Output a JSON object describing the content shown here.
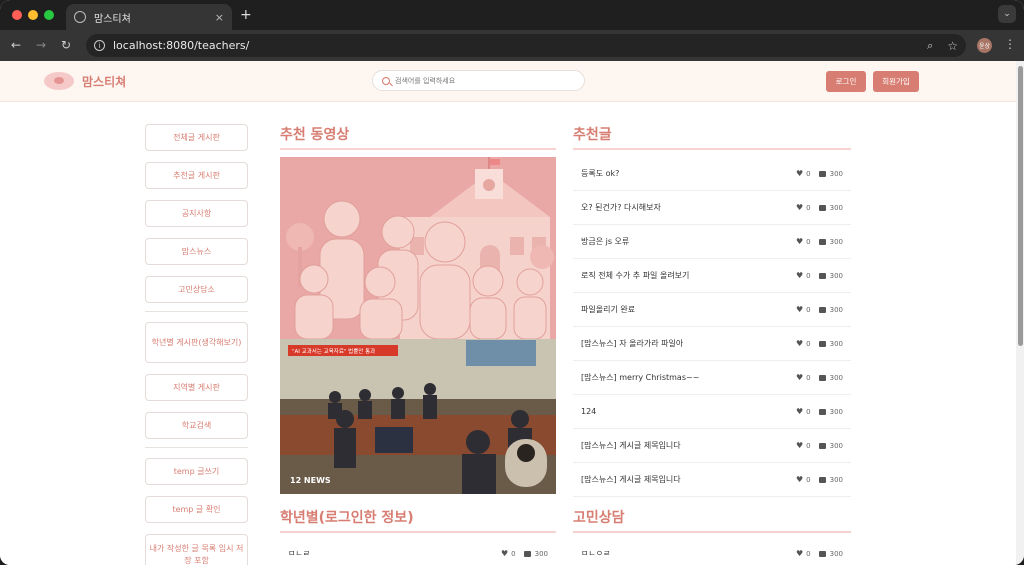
{
  "browser": {
    "tab_title": "맘스티쳐",
    "tab_close": "×",
    "new_tab": "+",
    "url": "localhost:8080/teachers/",
    "profile_initials": "윤상"
  },
  "header": {
    "brand": "맘스티쳐",
    "search_placeholder": "검색어를 입력하세요",
    "login_label": "로그인",
    "signup_label": "회원가입",
    "accent_color": "#d87d72"
  },
  "sidebar": {
    "group1": [
      "전체글 게시판",
      "추천글 게시판",
      "공지사항",
      "맘스뉴스",
      "고민상담소"
    ],
    "group2": [
      "학년별 게시판(생각해보기)",
      "지역별 게시판",
      "학교검색"
    ],
    "group3": [
      "temp 글쓰기",
      "temp 글 확인",
      "내가 작성한 글 목록 임시 저장 포함"
    ]
  },
  "sections": {
    "video_title": "추천 동영상",
    "recommended_title": "추천글",
    "grade_title": "학년별(로그인한 정보)",
    "counsel_title": "고민상담"
  },
  "video": {
    "news_banner": "\"AI 교과서는 교육자료\" 법률안 통과",
    "news_logo": "12 NEWS"
  },
  "recommended_posts": [
    {
      "title": "등록도 ok?",
      "likes": "0",
      "comments": "300"
    },
    {
      "title": "오? 된건가? 다시해보자",
      "likes": "0",
      "comments": "300"
    },
    {
      "title": "방금은 js 오류",
      "likes": "0",
      "comments": "300"
    },
    {
      "title": "로직 전체 수가 추 파일 올려보기",
      "likes": "0",
      "comments": "300"
    },
    {
      "title": "파일올리기 완료",
      "likes": "0",
      "comments": "300"
    },
    {
      "title": "[맘스뉴스] 자 올라가라 파일아",
      "likes": "0",
      "comments": "300"
    },
    {
      "title": "[맘스뉴스] merry Christmas~~",
      "likes": "0",
      "comments": "300"
    },
    {
      "title": "124",
      "likes": "0",
      "comments": "300"
    },
    {
      "title": "[맘스뉴스] 게시글 제목입니다",
      "likes": "0",
      "comments": "300"
    },
    {
      "title": "[맘스뉴스] 게시글 제목입니다",
      "likes": "0",
      "comments": "300"
    }
  ],
  "grade_posts": [
    {
      "title": "ㅁㄴㄹ",
      "likes": "0",
      "comments": "300"
    }
  ],
  "counsel_posts": [
    {
      "title": "ㅁㄴㅇㄹ",
      "likes": "0",
      "comments": "300"
    }
  ]
}
